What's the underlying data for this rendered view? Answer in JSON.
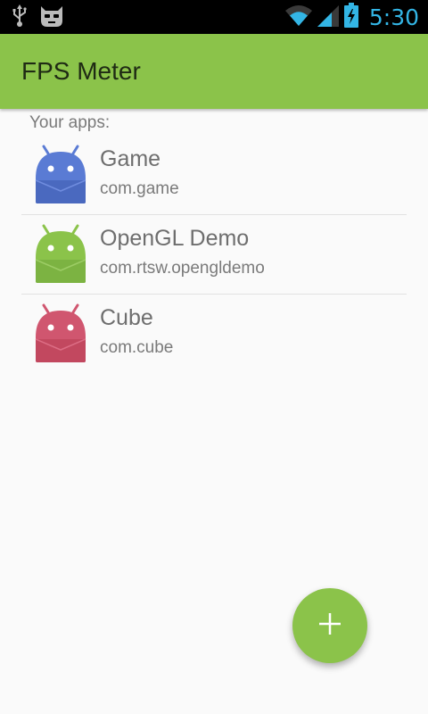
{
  "status_bar": {
    "time": "5:30",
    "time_color": "#33b5e5",
    "icons": [
      "usb-icon",
      "cyanogen-mascot-icon",
      "wifi-icon",
      "signal-icon",
      "battery-charging-icon"
    ]
  },
  "app_bar": {
    "title": "FPS Meter",
    "color": "#8bc34a"
  },
  "section_header": "Your apps:",
  "apps": [
    {
      "name": "Game",
      "package": "com.game",
      "icon_color": "#5a7bd4",
      "icon": "android-robot-icon"
    },
    {
      "name": "OpenGL Demo",
      "package": "com.rtsw.opengldemo",
      "icon_color": "#8bc34a",
      "icon": "android-robot-icon"
    },
    {
      "name": "Cube",
      "package": "com.cube",
      "icon_color": "#d0566f",
      "icon": "android-robot-icon"
    }
  ],
  "fab": {
    "icon": "plus-icon",
    "color": "#8bc34a"
  }
}
